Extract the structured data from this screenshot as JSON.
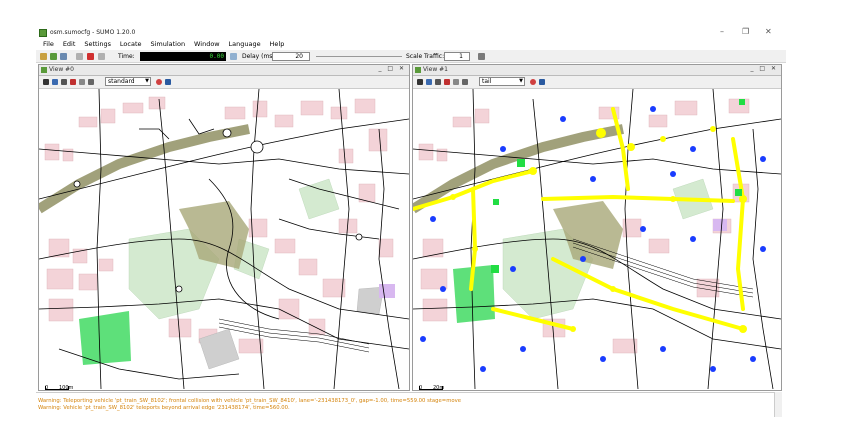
{
  "window": {
    "title": "osm.sumocfg - SUMO 1.20.0",
    "controls": [
      "–",
      "❐",
      "✕"
    ]
  },
  "menu": [
    "File",
    "Edit",
    "Settings",
    "Locate",
    "Simulation",
    "Window",
    "Language",
    "Help"
  ],
  "toolbar": {
    "time_label": "Time:",
    "time_value": "0.00",
    "delay_label": "Delay (ms):",
    "delay_value": "20",
    "scale_label": "Scale Traffic:",
    "scale_value": "1"
  },
  "views": [
    {
      "title": "View #0",
      "scheme": "standard",
      "scale_left": "0",
      "scale_right": "100m"
    },
    {
      "title": "View #1",
      "scheme": "tail",
      "scale_left": "0",
      "scale_right": "20m"
    }
  ],
  "messages": [
    "Warning: Teleporting vehicle 'pt_train_SW_8102'; frontal collision with vehicle 'pt_train_SW_8410', lane='-231438173_0', gap=-1.00, time=559.00 stage=move",
    "Warning: Vehicle 'pt_train_SW_8102' teleports beyond arrival edge '231438174', time=560.00."
  ],
  "colors": {
    "accent_time": "#3ade3a",
    "warning_text": "#d4830a",
    "tls_marker": "#ffff00",
    "junction_marker": "#0000ff",
    "park": "#d4ead0",
    "building": "#f3d3d8"
  }
}
